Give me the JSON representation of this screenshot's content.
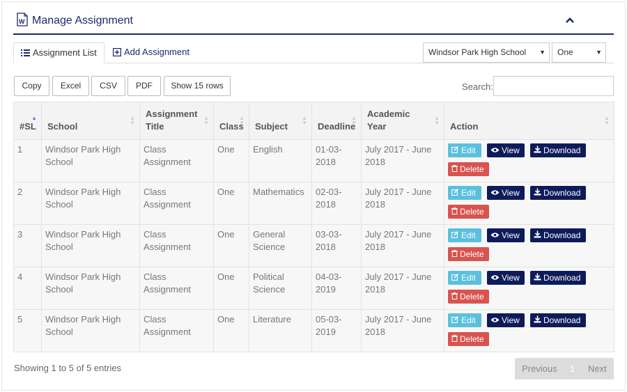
{
  "panel": {
    "title": "Manage Assignment"
  },
  "tabs": {
    "list_label": "Assignment List",
    "add_label": "Add Assignment"
  },
  "filters": {
    "school": "Windsor Park High School",
    "class": "One"
  },
  "toolbar": {
    "copy": "Copy",
    "excel": "Excel",
    "csv": "CSV",
    "pdf": "PDF",
    "show_rows": "Show 15 rows",
    "search_label": "Search:"
  },
  "table": {
    "headers": {
      "sl": "#SL",
      "school": "School",
      "title": "Assignment Title",
      "class": "Class",
      "subject": "Subject",
      "deadline": "Deadline",
      "year": "Academic Year",
      "action": "Action"
    },
    "action_labels": {
      "edit": "Edit",
      "view": "View",
      "download": "Download",
      "delete": "Delete"
    },
    "rows": [
      {
        "sl": "1",
        "school": "Windsor Park High School",
        "title": "Class Assignment",
        "class": "One",
        "subject": "English",
        "deadline": "01-03-2018",
        "year": "July 2017 - June 2018"
      },
      {
        "sl": "2",
        "school": "Windsor Park High School",
        "title": "Class Assignment",
        "class": "One",
        "subject": "Mathematics",
        "deadline": "02-03-2018",
        "year": "July 2017 - June 2018"
      },
      {
        "sl": "3",
        "school": "Windsor Park High School",
        "title": "Class Assignment",
        "class": "One",
        "subject": "General Science",
        "deadline": "03-03-2018",
        "year": "July 2017 - June 2018"
      },
      {
        "sl": "4",
        "school": "Windsor Park High School",
        "title": "Class Assignment",
        "class": "One",
        "subject": "Political Science",
        "deadline": "04-03-2019",
        "year": "July 2017 - June 2018"
      },
      {
        "sl": "5",
        "school": "Windsor Park High School",
        "title": "Class Assignment",
        "class": "One",
        "subject": "Literature",
        "deadline": "05-03-2019",
        "year": "July 2017 - June 2018"
      }
    ]
  },
  "footer": {
    "info": "Showing 1 to 5 of 5 entries",
    "previous": "Previous",
    "page": "1",
    "next": "Next"
  },
  "colors": {
    "primary": "#1b2a6b",
    "edit": "#5bc0de",
    "view": "#0e1b5a",
    "delete": "#d9534f"
  },
  "icons": {
    "title": "word-document-icon",
    "collapse": "chevron-up-icon",
    "list": "list-icon",
    "add": "plus-square-icon",
    "edit": "edit-icon",
    "view": "eye-icon",
    "download": "download-icon",
    "delete": "trash-icon"
  }
}
